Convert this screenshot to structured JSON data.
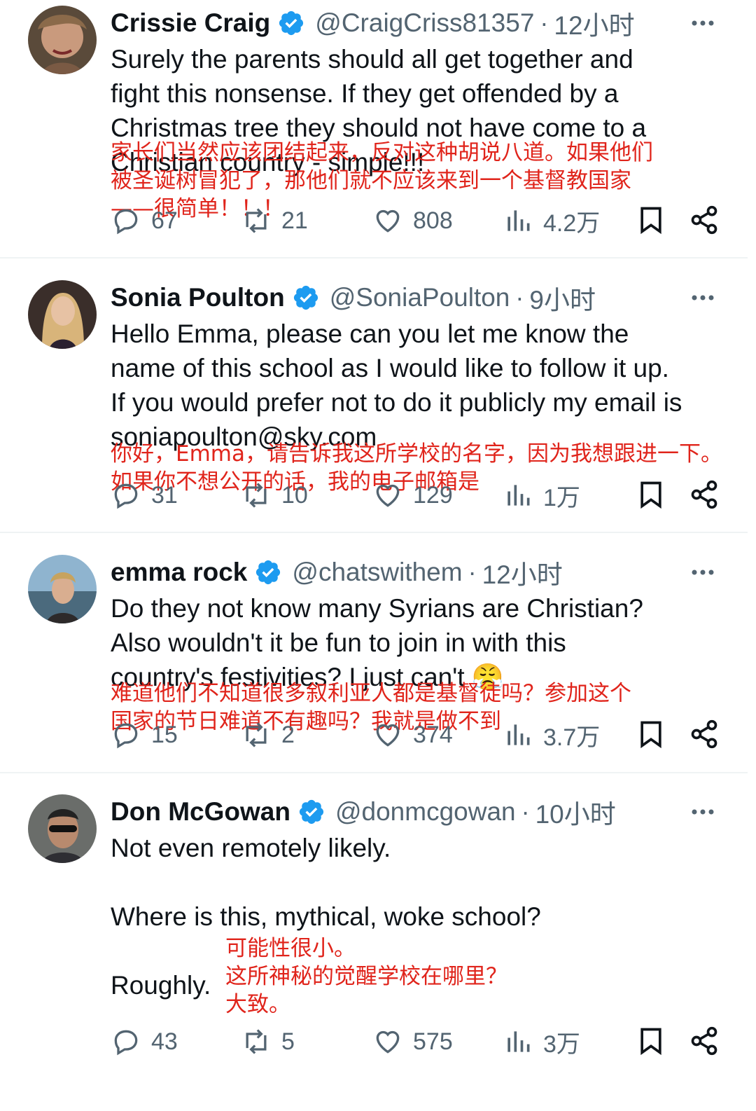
{
  "tweets": [
    {
      "name": "Crissie Craig",
      "handle": "@CraigCriss81357",
      "time": "12小时",
      "text": [
        "Surely the parents should all get together and",
        "fight this nonsense. If they get offended by a",
        "Christmas tree they should not have come to a",
        "Christian country - simple!!!"
      ],
      "translation": [
        "家长们当然应该团结起来，反对这种胡说八道。如果他们",
        "被圣诞树冒犯了，那他们就不应该来到一个基督教国家",
        "——很简单！！！"
      ],
      "replies": "67",
      "retweets": "21",
      "likes": "808",
      "views": "4.2万"
    },
    {
      "name": "Sonia Poulton",
      "handle": "@SoniaPoulton",
      "time": "9小时",
      "text": [
        "Hello Emma, please can you let me know the",
        "name of this school as I would like to follow it up.",
        "If you would prefer not to do it publicly my email is",
        "soniapoulton@sky.com"
      ],
      "translation": [
        "你好，Emma，请告诉我这所学校的名字，因为我想跟进一下。",
        "如果你不想公开的话，我的电子邮箱是"
      ],
      "replies": "31",
      "retweets": "10",
      "likes": "129",
      "views": "1万"
    },
    {
      "name": "emma rock",
      "handle": "@chatswithem",
      "time": "12小时",
      "text": [
        "Do they not know many Syrians are Christian?",
        "Also wouldn't it be fun to join in with this",
        "country's festivities? I just can't 😤"
      ],
      "translation": [
        "难道他们不知道很多叙利亚人都是基督徒吗？参加这个",
        "国家的节日难道不有趣吗？我就是做不到"
      ],
      "replies": "15",
      "retweets": "2",
      "likes": "374",
      "views": "3.7万"
    },
    {
      "name": "Don McGowan",
      "handle": "@donmcgowan",
      "time": "10小时",
      "text": [
        "Not even remotely likely.",
        "",
        "Where is this, mythical, woke school?",
        "",
        "Roughly."
      ],
      "translation": [
        "可能性很小。",
        "这所神秘的觉醒学校在哪里？",
        "大致。"
      ],
      "replies": "43",
      "retweets": "5",
      "likes": "575",
      "views": "3万"
    }
  ],
  "colors": {
    "verified": "#1d9bf0",
    "secondary": "#536471",
    "overlay_red": "#e0241b"
  },
  "icons": [
    "verified-badge-icon",
    "more-icon",
    "reply-icon",
    "retweet-icon",
    "like-icon",
    "views-icon",
    "bookmark-icon",
    "share-icon"
  ]
}
